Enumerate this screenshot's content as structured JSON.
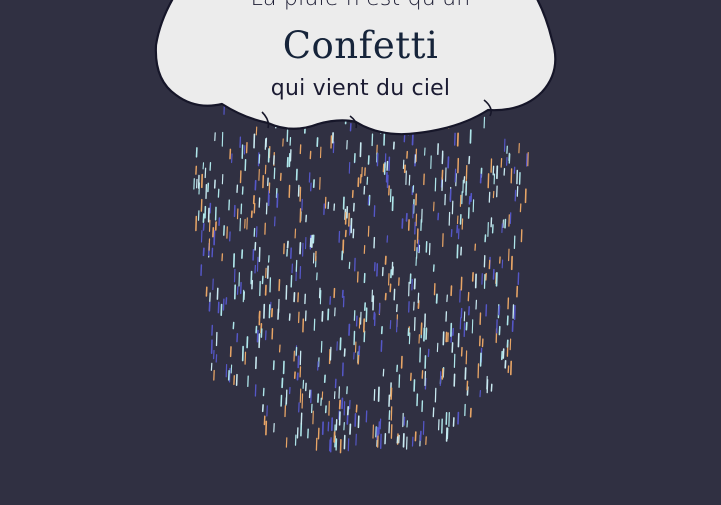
{
  "cloud": {
    "line1": "La pluie n'est qu'un",
    "line2": "Confetti",
    "line3": "qui vient du ciel"
  },
  "colors": {
    "background": "#303042",
    "cloud_fill": "#ececec",
    "cloud_outline": "#161629",
    "text": "#1b1b32",
    "confetti": [
      "#aee6ea",
      "#e8a566",
      "#5557c8",
      "#c9eaf1"
    ]
  }
}
